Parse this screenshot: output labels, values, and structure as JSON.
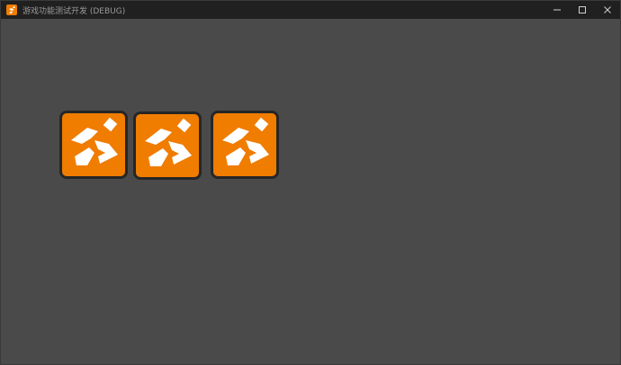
{
  "window": {
    "title": "游戏功能测试开发 (DEBUG)"
  },
  "icons": {
    "app": "godot-engine-logo-icon",
    "minimize": "minimize-icon",
    "maximize": "maximize-icon",
    "close": "close-icon",
    "sprite": "running-figure-icon"
  },
  "colors": {
    "titlebar": "#202020",
    "canvas": "#4a4a4a",
    "sprite_fill": "#f07c00",
    "sprite_border": "#262626",
    "glyph": "#ffffff"
  }
}
